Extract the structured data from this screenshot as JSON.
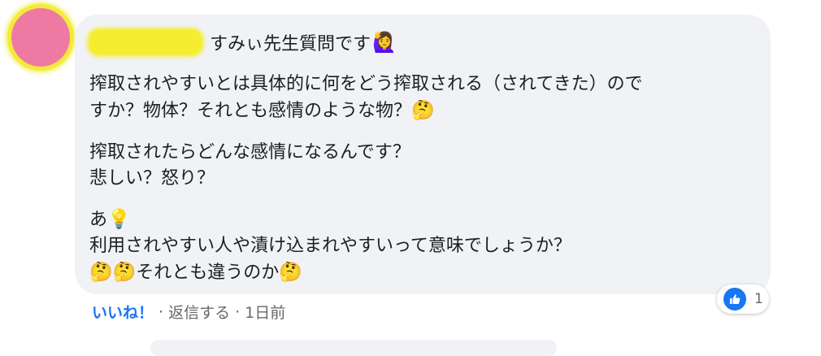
{
  "comment": {
    "author_suffix": "すみぃ先生質問です",
    "author_emoji": "🙋‍♀️",
    "paragraph1": {
      "line1": "搾取されやすいとは具体的に何をどう搾取される（されてきた）ので",
      "line2": "すか？物体？それとも感情のような物？",
      "line2_emoji": "🤔"
    },
    "paragraph2": {
      "line1": "搾取されたらどんな感情になるんです？",
      "line2": "悲しい？怒り？"
    },
    "paragraph3": {
      "line1": "あ",
      "line1_emoji": "💡",
      "line2": "利用されやすい人や漬け込まれやすいって意味でしょうか？",
      "line3_emoji1": "🤔",
      "line3_emoji2": "🤔",
      "line3_text": "それとも違うのか",
      "line3_emoji3": "🤔"
    }
  },
  "reaction": {
    "icon": "thumbs-up-icon",
    "count": "1",
    "color": "#1877f2"
  },
  "actions": {
    "like": "いいね！",
    "separator": "·",
    "reply": "返信する",
    "time": "1日前"
  }
}
